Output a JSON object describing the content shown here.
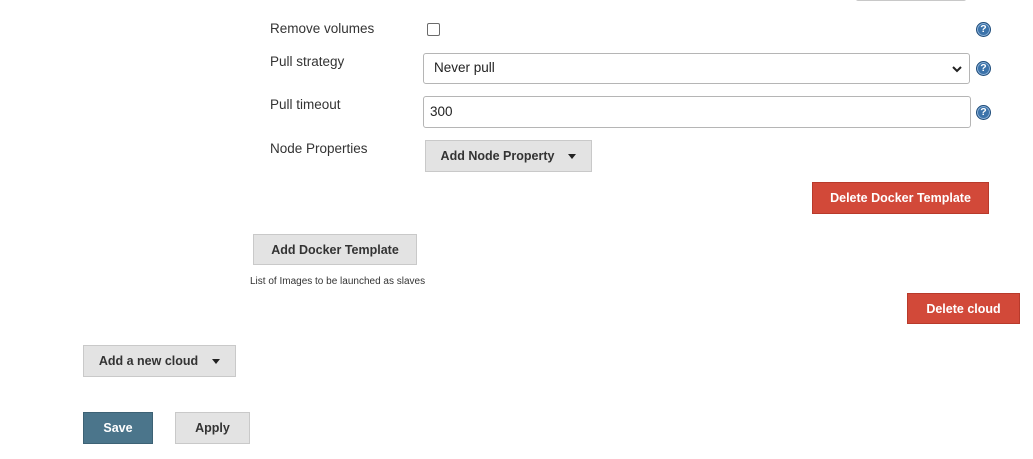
{
  "docker_template": {
    "remove_volumes": {
      "label": "Remove volumes",
      "checked": false
    },
    "pull_strategy": {
      "label": "Pull strategy",
      "selected": "Never pull"
    },
    "pull_timeout": {
      "label": "Pull timeout",
      "value": "300"
    },
    "node_properties": {
      "label": "Node Properties",
      "add_button": "Add Node Property"
    },
    "delete_template_button": "Delete Docker Template"
  },
  "templates": {
    "add_button": "Add Docker Template",
    "description": "List of Images to be launched as slaves"
  },
  "cloud": {
    "delete_button": "Delete cloud",
    "add_new_button": "Add a new cloud"
  },
  "form_actions": {
    "save": "Save",
    "apply": "Apply"
  },
  "icons": {
    "help": "help-icon",
    "dropdown": "chevron-down-icon",
    "caret": "caret-down-icon"
  },
  "colors": {
    "danger": "#d24939",
    "primary": "#4b758b",
    "secondary": "#e3e3e3",
    "help": "#3c73aa"
  }
}
